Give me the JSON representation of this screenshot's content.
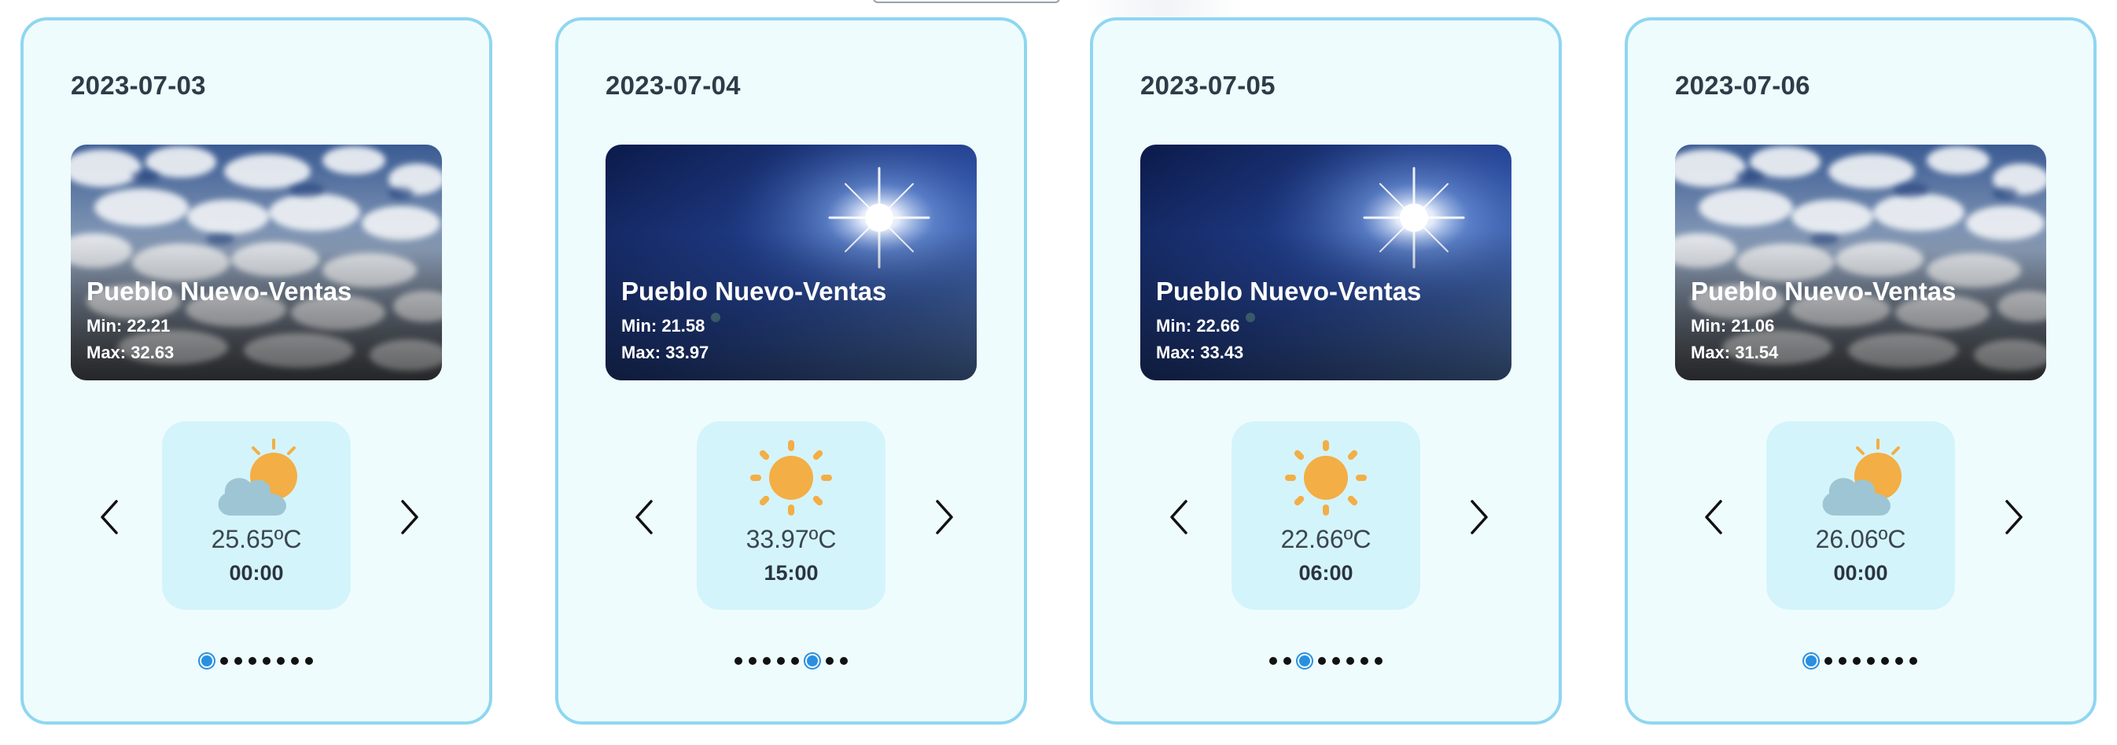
{
  "cards": [
    {
      "date": "2023-07-03",
      "photo": "cloudy-sky",
      "city": "Pueblo Nuevo-Ventas",
      "min": "Min: 22.21",
      "max": "Max: 32.63",
      "icon": "partly-cloudy-icon",
      "temp": "25.65ºC",
      "time": "00:00",
      "dots_total": 8,
      "active_dot": 0
    },
    {
      "date": "2023-07-04",
      "photo": "sunny-sky",
      "city": "Pueblo Nuevo-Ventas",
      "min": "Min: 21.58",
      "max": "Max: 33.97",
      "icon": "sun-icon",
      "temp": "33.97ºC",
      "time": "15:00",
      "dots_total": 8,
      "active_dot": 5
    },
    {
      "date": "2023-07-05",
      "photo": "sunny-sky",
      "city": "Pueblo Nuevo-Ventas",
      "min": "Min: 22.66",
      "max": "Max: 33.43",
      "icon": "sun-icon",
      "temp": "22.66ºC",
      "time": "06:00",
      "dots_total": 8,
      "active_dot": 2
    },
    {
      "date": "2023-07-06",
      "photo": "cloudy-sky",
      "city": "Pueblo Nuevo-Ventas",
      "min": "Min: 21.06",
      "max": "Max: 31.54",
      "icon": "partly-cloudy-icon",
      "temp": "26.06ºC",
      "time": "00:00",
      "dots_total": 8,
      "active_dot": 0
    }
  ],
  "colors": {
    "card_border": "#8fd6f1",
    "card_background": "#effcfe",
    "slide_background": "#d4f4fb",
    "sun": "#f3ae45",
    "cloud": "#9ec5d3",
    "active_dot": "#2a8fe0"
  }
}
